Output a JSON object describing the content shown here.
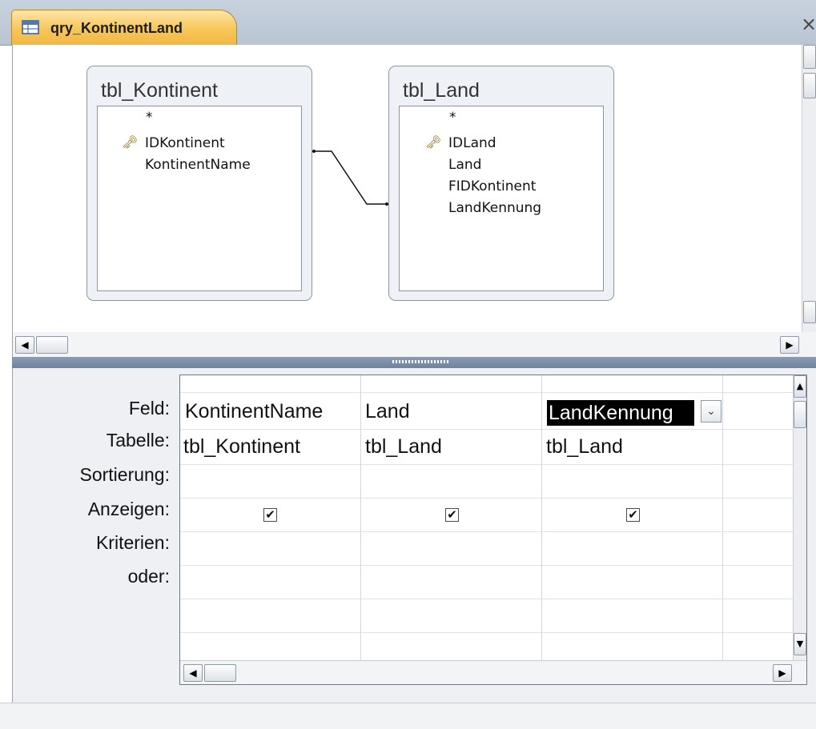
{
  "tab": {
    "title": "qry_KontinentLand",
    "close_glyph": "×"
  },
  "tables": [
    {
      "name": "tbl_Kontinent",
      "fields": [
        "*",
        "IDKontinent",
        "KontinentName"
      ],
      "key_field": "IDKontinent"
    },
    {
      "name": "tbl_Land",
      "fields": [
        "*",
        "IDLand",
        "Land",
        "FIDKontinent",
        "LandKennung"
      ],
      "key_field": "IDLand"
    }
  ],
  "grid": {
    "row_labels": [
      "Feld:",
      "Tabelle:",
      "Sortierung:",
      "Anzeigen:",
      "Kriterien:",
      "oder:"
    ],
    "columns": [
      {
        "field": "KontinentName",
        "table": "tbl_Kontinent",
        "show": true
      },
      {
        "field": "Land",
        "table": "tbl_Land",
        "show": true
      },
      {
        "field": "LandKennung",
        "table": "tbl_Land",
        "show": true,
        "selected": true
      }
    ]
  },
  "icons": {
    "key": "🗝",
    "check": "✔",
    "left_arrow": "◀",
    "right_arrow": "▶",
    "up_arrow": "▲",
    "down_arrow": "▼",
    "dropdown": "⌄"
  }
}
